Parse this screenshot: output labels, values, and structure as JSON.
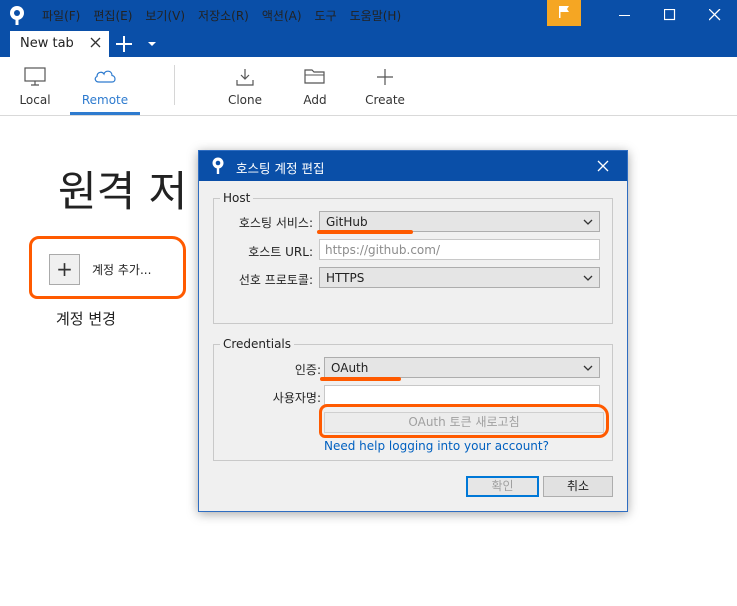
{
  "window": {
    "menu": [
      "파일(F)",
      "편집(E)",
      "보기(V)",
      "저장소(R)",
      "액션(A)",
      "도구",
      "도움말(H)"
    ],
    "accent_color": "#0a4fa8",
    "flag_color": "#f5a623",
    "controls": [
      "minimize-icon",
      "maximize-icon",
      "close-icon"
    ]
  },
  "tabs": {
    "active_tab": "New tab"
  },
  "toolbar": {
    "local": "Local",
    "remote": "Remote",
    "clone": "Clone",
    "add": "Add",
    "create": "Create"
  },
  "page": {
    "title": "원격 저",
    "add_account": "계정 추가...",
    "change_account": "계정 변경"
  },
  "dialog": {
    "title": "호스팅 계정 편집",
    "host_group": "Host",
    "hosting_service_label": "호스팅 서비스:",
    "hosting_service_value": "GitHub",
    "host_url_label": "호스트 URL:",
    "host_url_placeholder": "https://github.com/",
    "protocol_label": "선호 프로토콜:",
    "protocol_value": "HTTPS",
    "credentials_group": "Credentials",
    "auth_label": "인증:",
    "auth_value": "OAuth",
    "username_label": "사용자명:",
    "username_value": "",
    "refresh_token_button": "OAuth 토큰 새로고침",
    "help_link": "Need help logging into your account?",
    "ok_button": "확인",
    "cancel_button": "취소"
  },
  "annotation_color": "#ff5a00"
}
